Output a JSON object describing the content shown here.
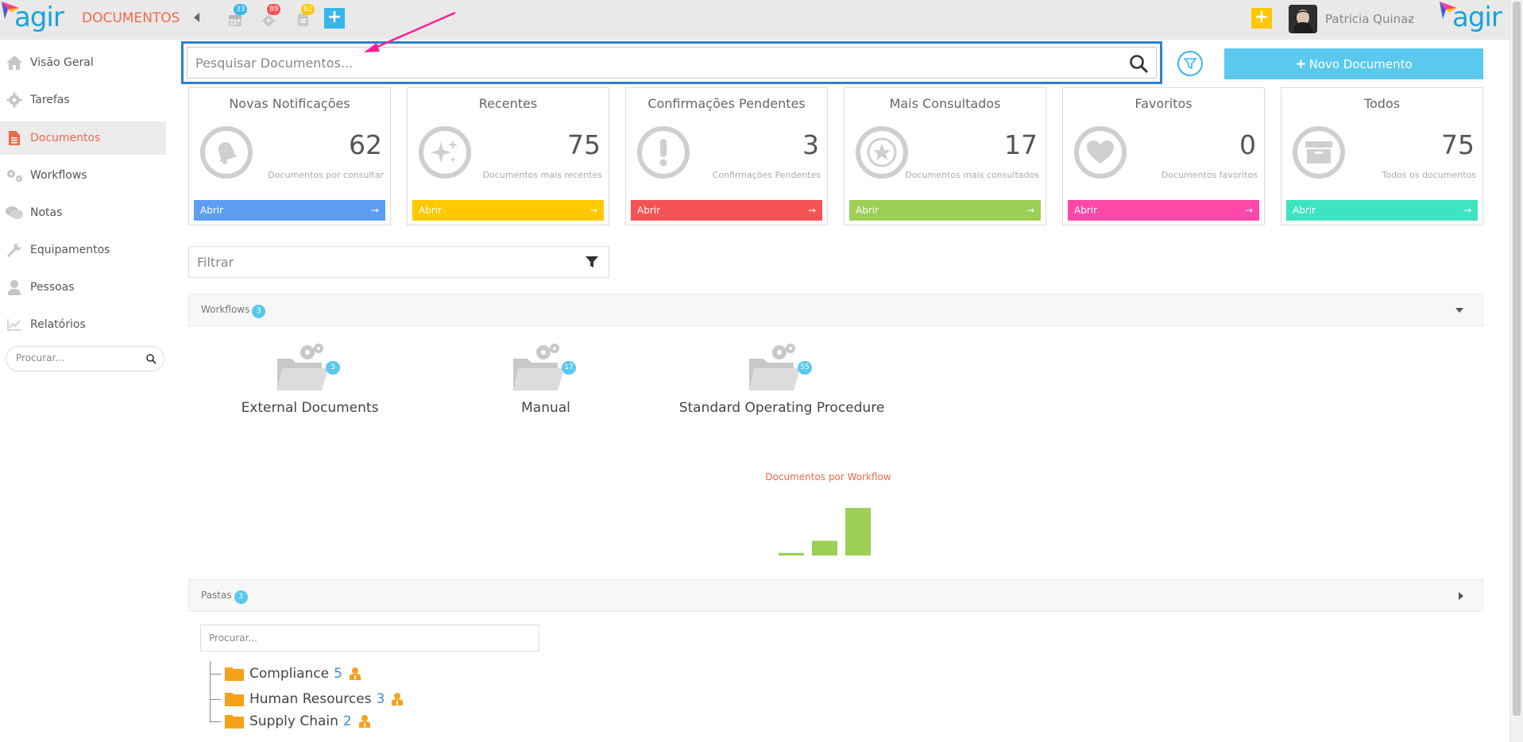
{
  "header": {
    "brand": "agir",
    "module_title": "DOCUMENTOS",
    "badges": {
      "calendar": "33",
      "tasks": "89",
      "documents": "62"
    },
    "user_name": "Patricia Quinaz"
  },
  "sidebar": {
    "items": [
      {
        "label": "Visão Geral",
        "icon": "home-icon"
      },
      {
        "label": "Tarefas",
        "icon": "gear-icon"
      },
      {
        "label": "Documentos",
        "icon": "document-icon",
        "active": true
      },
      {
        "label": "Workflows",
        "icon": "gears-icon"
      },
      {
        "label": "Notas",
        "icon": "chat-icon"
      },
      {
        "label": "Equipamentos",
        "icon": "wrench-icon"
      },
      {
        "label": "Pessoas",
        "icon": "person-icon"
      },
      {
        "label": "Relatórios",
        "icon": "chart-icon"
      }
    ],
    "search_placeholder": "Procurar..."
  },
  "search": {
    "placeholder": "Pesquisar Documentos..."
  },
  "new_document_label": "Novo Documento",
  "cards": [
    {
      "title": "Novas Notificações",
      "value": "62",
      "subtitle": "Documentos por consultar",
      "open": "Abrir",
      "color": "#5b9ef2",
      "icon": "bell-icon"
    },
    {
      "title": "Recentes",
      "value": "75",
      "subtitle": "Documentos mais recentes",
      "open": "Abrir",
      "color": "#ffc800",
      "icon": "sparkle-icon"
    },
    {
      "title": "Confirmações Pendentes",
      "value": "3",
      "subtitle": "Confirmações Pendentes",
      "open": "Abrir",
      "color": "#f55353",
      "icon": "exclamation-icon"
    },
    {
      "title": "Mais Consultados",
      "value": "17",
      "subtitle": "Documentos mais consultados",
      "open": "Abrir",
      "color": "#9ccf55",
      "icon": "star-icon"
    },
    {
      "title": "Favoritos",
      "value": "0",
      "subtitle": "Documentos favoritos",
      "open": "Abrir",
      "color": "#ff47a8",
      "icon": "heart-icon"
    },
    {
      "title": "Todos",
      "value": "75",
      "subtitle": "Todos os documentos",
      "open": "Abrir",
      "color": "#3de4c0",
      "icon": "archive-icon"
    }
  ],
  "filter": {
    "placeholder": "Filtrar"
  },
  "workflows_section": {
    "label": "Workflows",
    "count": "3"
  },
  "workflows": [
    {
      "name": "External Documents",
      "count": "3"
    },
    {
      "name": "Manual",
      "count": "17"
    },
    {
      "name": "Standard Operating Procedure",
      "count": "55"
    }
  ],
  "chart_data": {
    "type": "bar",
    "title": "Documentos por Workflow",
    "categories": [
      "External Documents",
      "Manual",
      "Standard Operating Procedure"
    ],
    "values": [
      3,
      17,
      55
    ],
    "color": "#9ccf55"
  },
  "folders_section": {
    "label": "Pastas",
    "count": "3",
    "search_placeholder": "Procurar..."
  },
  "folders": [
    {
      "name": "Compliance",
      "count": "5"
    },
    {
      "name": "Human Resources",
      "count": "3"
    },
    {
      "name": "Supply Chain",
      "count": "2"
    }
  ]
}
